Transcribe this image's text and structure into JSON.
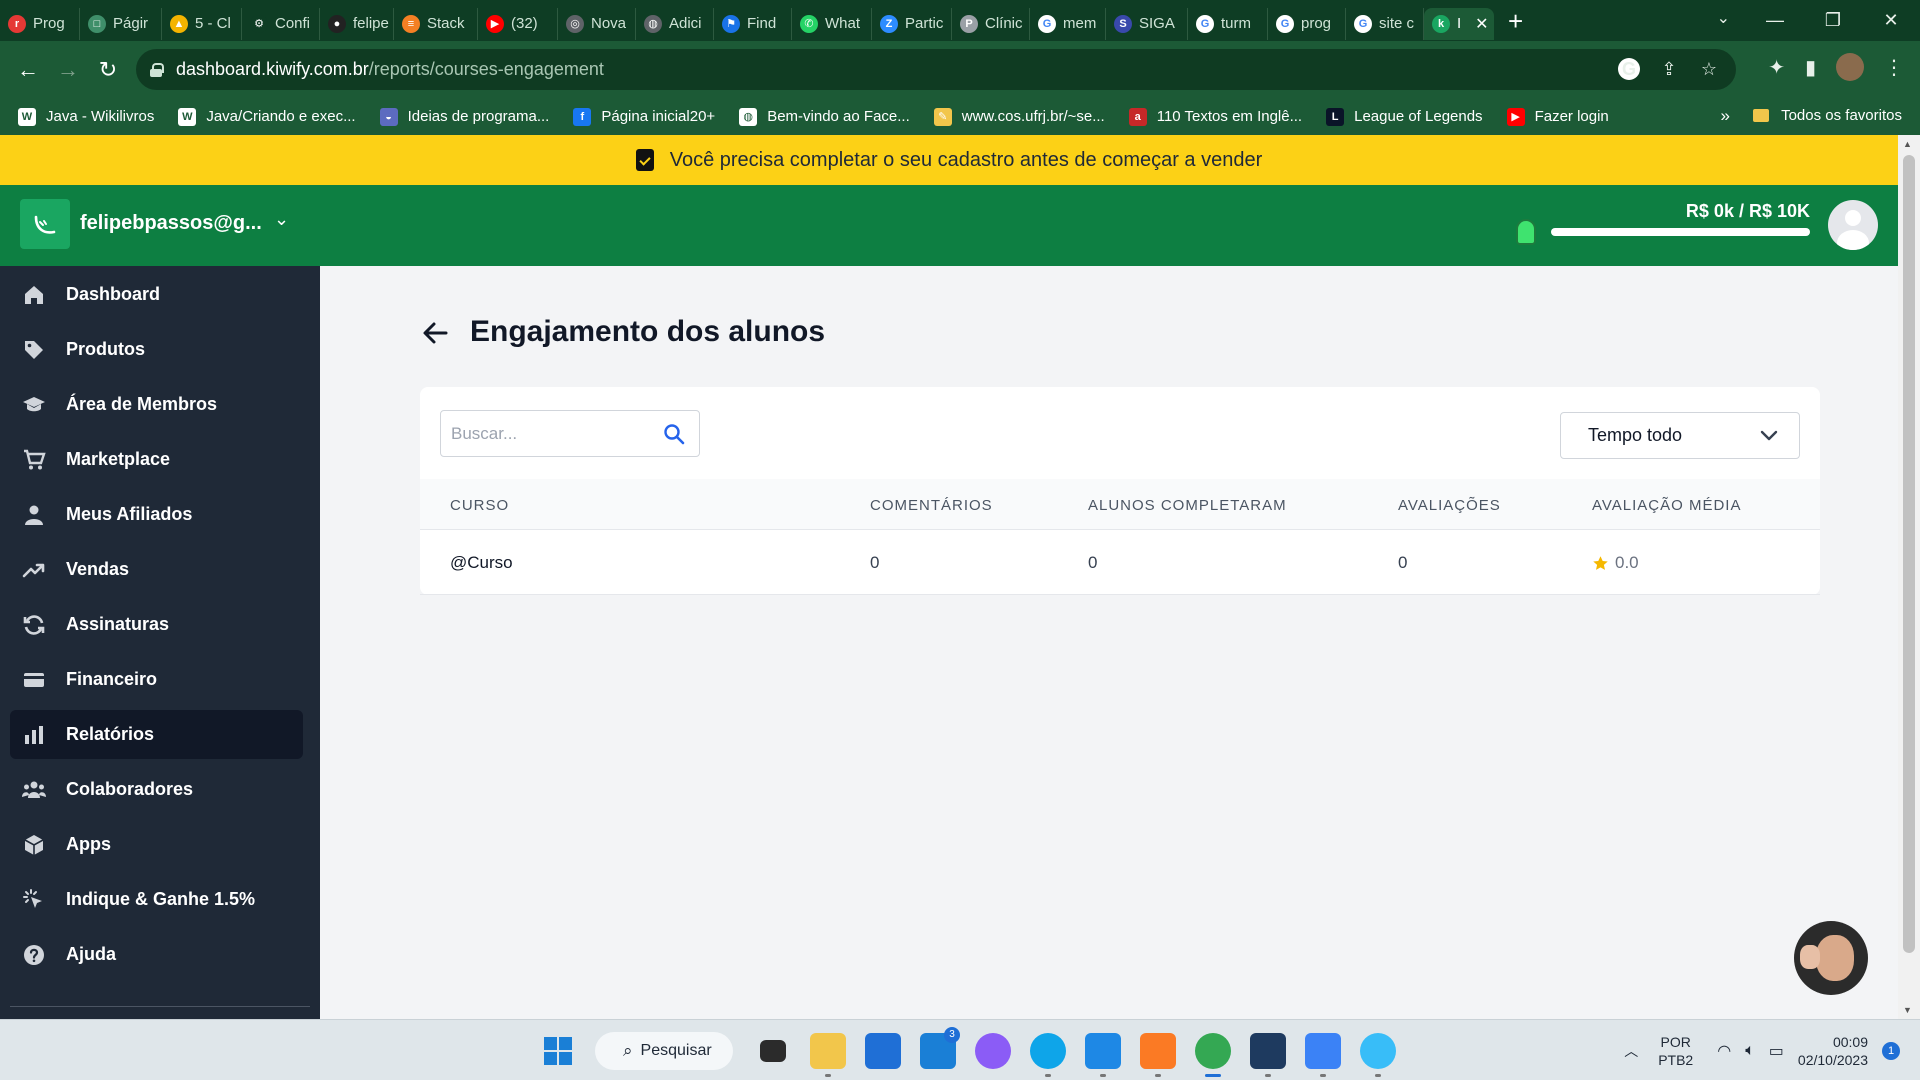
{
  "browser": {
    "tabs": [
      {
        "label": "Prog",
        "icon": "rec-icon",
        "color": "#e53935",
        "glyph": "r"
      },
      {
        "label": "Págir",
        "icon": "page-icon",
        "color": "#3f8f6a",
        "glyph": "□"
      },
      {
        "label": "5 - Cl",
        "icon": "drive-icon",
        "color": "#f4b400",
        "glyph": "▲"
      },
      {
        "label": "Confi",
        "icon": "gear-icon",
        "color": "#0e3d24",
        "glyph": "⚙"
      },
      {
        "label": "felipe",
        "icon": "github-icon",
        "color": "#222222",
        "glyph": "●"
      },
      {
        "label": "Stack",
        "icon": "stackoverflow-icon",
        "color": "#f48024",
        "glyph": "≡"
      },
      {
        "label": "(32) ",
        "icon": "youtube-icon",
        "color": "#ff0000",
        "glyph": "▶"
      },
      {
        "label": "Nova",
        "icon": "chrome-icon",
        "color": "#5f6368",
        "glyph": "◎"
      },
      {
        "label": "Adici",
        "icon": "globe-icon",
        "color": "#5f6368",
        "glyph": "◍"
      },
      {
        "label": "Find",
        "icon": "flag-icon",
        "color": "#1a73e8",
        "glyph": "⚑"
      },
      {
        "label": "What",
        "icon": "whatsapp-icon",
        "color": "#25d366",
        "glyph": "✆"
      },
      {
        "label": "Partic",
        "icon": "zoom-icon",
        "color": "#2d8cff",
        "glyph": "Z"
      },
      {
        "label": "Clínic",
        "icon": "clinic-icon",
        "color": "#9aa0a6",
        "glyph": "P"
      },
      {
        "label": "mem",
        "icon": "google-icon",
        "color": "#ffffff",
        "glyph": "G"
      },
      {
        "label": "SIGA",
        "icon": "siga-icon",
        "color": "#3949ab",
        "glyph": "S"
      },
      {
        "label": "turm",
        "icon": "google-icon",
        "color": "#ffffff",
        "glyph": "G"
      },
      {
        "label": "prog",
        "icon": "google-icon",
        "color": "#ffffff",
        "glyph": "G"
      },
      {
        "label": "site c",
        "icon": "google-icon",
        "color": "#ffffff",
        "glyph": "G"
      },
      {
        "label": "I",
        "icon": "kiwify-icon",
        "color": "#1aa661",
        "glyph": "k"
      }
    ],
    "new_tab": "+",
    "window_controls": [
      "—",
      "❐",
      "✕"
    ],
    "url_host": "dashboard.kiwify.com.br",
    "url_path": "/reports/courses-engagement",
    "bookmarks": [
      {
        "label": "Java - Wikilivros",
        "color": "#ffffff",
        "glyph": "W"
      },
      {
        "label": "Java/Criando e exec...",
        "color": "#ffffff",
        "glyph": "W"
      },
      {
        "label": "Ideias de programa...",
        "color": "#5c6bc0",
        "glyph": "◒"
      },
      {
        "label": "Página inicial20+",
        "color": "#1877f2",
        "glyph": "f"
      },
      {
        "label": "Bem-vindo ao Face...",
        "color": "#ffffff",
        "glyph": "◍"
      },
      {
        "label": "www.cos.ufrj.br/~se...",
        "color": "#f2c64b",
        "glyph": "✎"
      },
      {
        "label": "110 Textos em Inglê...",
        "color": "#c62828",
        "glyph": "a"
      },
      {
        "label": "League of Legends",
        "color": "#0a1428",
        "glyph": "L"
      },
      {
        "label": "Fazer login",
        "color": "#ff0000",
        "glyph": "▶"
      }
    ],
    "bookmarks_more": "»",
    "all_bookmarks": "Todos os favoritos"
  },
  "banner": {
    "text": "Você precisa completar o seu cadastro antes de começar a vender"
  },
  "header": {
    "account": "felipebpassos@g...",
    "goal_label": "R$ 0k / R$ 10K",
    "goal_progress": 0
  },
  "sidebar": {
    "items": [
      {
        "label": "Dashboard",
        "icon": "home-icon"
      },
      {
        "label": "Produtos",
        "icon": "tag-icon"
      },
      {
        "label": "Área de Membros",
        "icon": "graduation-cap-icon"
      },
      {
        "label": "Marketplace",
        "icon": "cart-icon"
      },
      {
        "label": "Meus Afiliados",
        "icon": "user-icon"
      },
      {
        "label": "Vendas",
        "icon": "trending-up-icon"
      },
      {
        "label": "Assinaturas",
        "icon": "refresh-icon"
      },
      {
        "label": "Financeiro",
        "icon": "credit-card-icon"
      },
      {
        "label": "Relatórios",
        "icon": "bar-chart-icon",
        "active": true
      },
      {
        "label": "Colaboradores",
        "icon": "users-icon"
      },
      {
        "label": "Apps",
        "icon": "cube-icon"
      },
      {
        "label": "Indique & Ganhe 1.5%",
        "icon": "cursor-click-icon"
      },
      {
        "label": "Ajuda",
        "icon": "help-icon"
      }
    ]
  },
  "page": {
    "title": "Engajamento dos alunos",
    "search_placeholder": "Buscar...",
    "period": "Tempo todo",
    "columns": [
      "CURSO",
      "COMENTÁRIOS",
      "ALUNOS COMPLETARAM",
      "AVALIAÇÕES",
      "AVALIAÇÃO MÉDIA"
    ],
    "rows": [
      {
        "course": "@Curso",
        "comments": "0",
        "completed": "0",
        "reviews": "0",
        "avg_rating": "0.0"
      }
    ]
  },
  "taskbar": {
    "search_label": "Pesquisar",
    "mail_badge": "3",
    "lang_line1": "POR",
    "lang_line2": "PTB2",
    "time": "00:09",
    "date": "02/10/2023",
    "notification_count": "1"
  }
}
